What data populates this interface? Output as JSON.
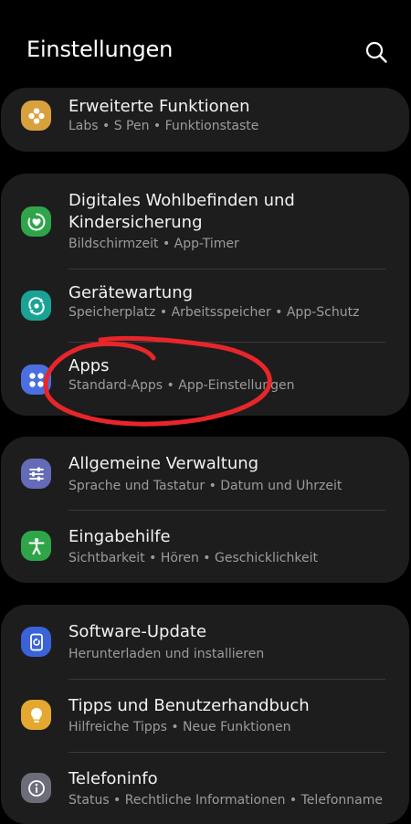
{
  "header": {
    "title": "Einstellungen",
    "search_icon": "search-icon"
  },
  "colors": {
    "background": "#000000",
    "card": "#1d1d1e",
    "subtitle": "#9c9c9c",
    "annotation": "#e8262a"
  },
  "sections": [
    {
      "items": [
        {
          "title": "Erweiterte Funktionen",
          "subtitle": "Labs  •  S Pen  •  Funktionstaste",
          "icon": "flower-gear-icon",
          "icon_color": "#d9a13d"
        }
      ]
    },
    {
      "items": [
        {
          "title": "Digitales Wohlbefinden und Kindersicherung",
          "subtitle": "Bildschirmzeit  •  App-Timer",
          "icon": "wellbeing-icon",
          "icon_color": "#2fa54a"
        },
        {
          "title": "Gerätewartung",
          "subtitle": "Speicherplatz  •  Arbeitsspeicher  •  App-Schutz",
          "icon": "device-care-icon",
          "icon_color": "#1aa394"
        },
        {
          "title": "Apps",
          "subtitle": "Standard-Apps  •  App-Einstellungen",
          "icon": "apps-icon",
          "icon_color": "#4a6fe0"
        }
      ]
    },
    {
      "items": [
        {
          "title": "Allgemeine Verwaltung",
          "subtitle": "Sprache und Tastatur  •  Datum und Uhrzeit",
          "icon": "sliders-icon",
          "icon_color": "#646cb8"
        },
        {
          "title": "Eingabehilfe",
          "subtitle": "Sichtbarkeit  •  Hören  •  Geschicklichkeit",
          "icon": "accessibility-icon",
          "icon_color": "#2fa54a"
        }
      ]
    },
    {
      "items": [
        {
          "title": "Software-Update",
          "subtitle": "Herunterladen und installieren",
          "icon": "software-update-icon",
          "icon_color": "#3a63d8"
        },
        {
          "title": "Tipps und Benutzerhandbuch",
          "subtitle": "Hilfreiche Tipps  •  Neue Funktionen",
          "icon": "lightbulb-icon",
          "icon_color": "#e4a830"
        },
        {
          "title": "Telefoninfo",
          "subtitle": "Status  •  Rechtliche Informationen  •  Telefonname",
          "icon": "info-icon",
          "icon_color": "#6b6e7a"
        }
      ]
    }
  ]
}
